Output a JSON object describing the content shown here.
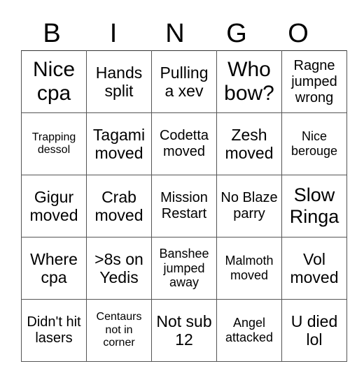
{
  "header": [
    "B",
    "I",
    "N",
    "G",
    "O"
  ],
  "cells": [
    [
      "Nice cpa",
      "Hands split",
      "Pulling a xev",
      "Who bow?",
      "Ragne jumped wrong"
    ],
    [
      "Trapping dessol",
      "Tagami moved",
      "Codetta moved",
      "Zesh moved",
      "Nice berouge"
    ],
    [
      "Gigur moved",
      "Crab moved",
      "Mission Restart",
      "No Blaze parry",
      "Slow Ringa"
    ],
    [
      "Where cpa",
      ">8s on Yedis",
      "Banshee jumped away",
      "Malmoth moved",
      "Vol moved"
    ],
    [
      "Didn't hit lasers",
      "Centaurs not in corner",
      "Not sub 12",
      "Angel attacked",
      "U died lol"
    ]
  ]
}
